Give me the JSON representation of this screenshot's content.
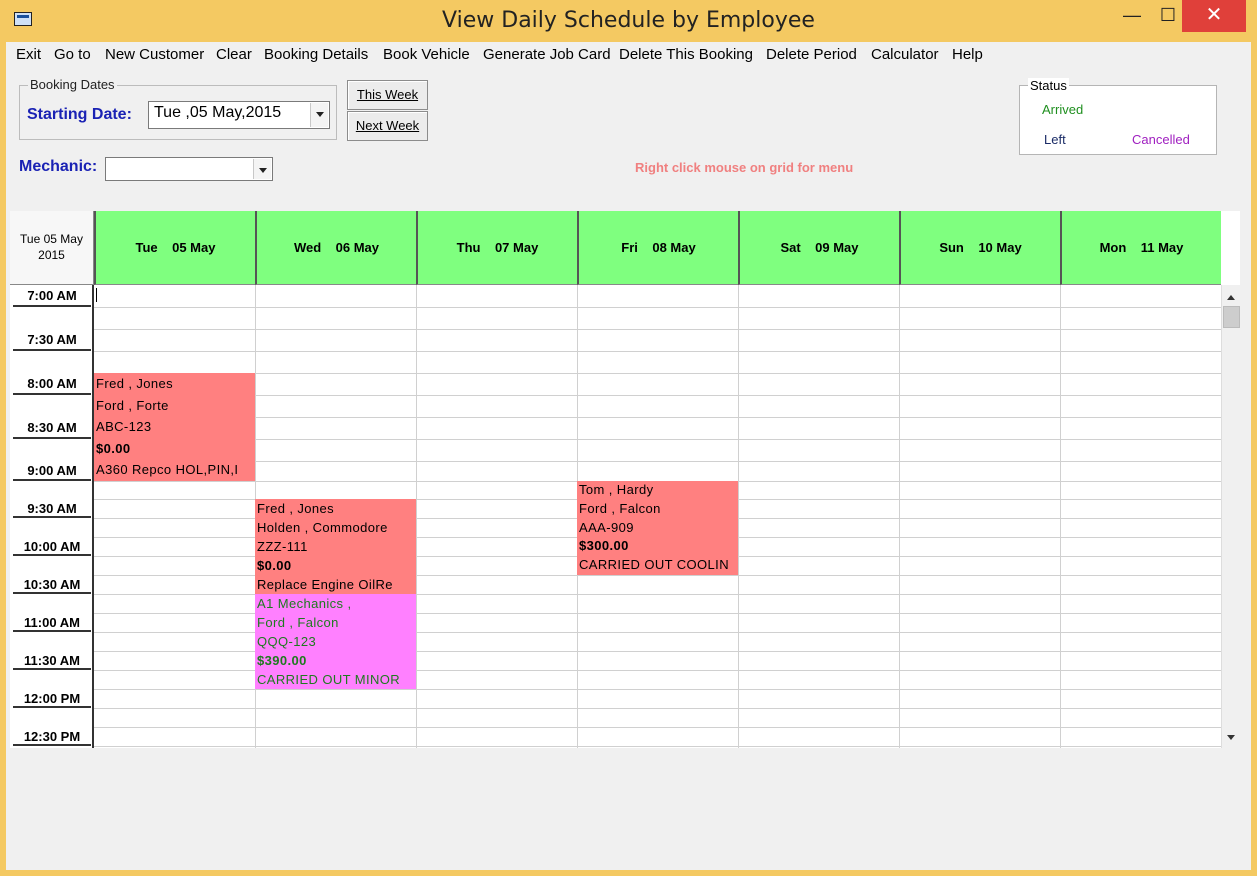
{
  "window": {
    "title": "View Daily Schedule by Employee",
    "minimize": "—",
    "maximize": "☐",
    "close": "✕"
  },
  "menu": [
    "Exit",
    "Go to",
    "New Customer",
    "Clear",
    "Booking Details",
    "Book Vehicle",
    "Generate Job Card",
    "Delete This Booking",
    "Delete Period",
    "Calculator",
    "Help"
  ],
  "booking_dates": {
    "legend": "Booking Dates",
    "starting_label": "Starting Date:",
    "starting_value": "Tue ,05 May,2015",
    "this_week": "This Week",
    "next_week": "Next Week"
  },
  "mechanic": {
    "label": "Mechanic:",
    "value": ""
  },
  "hint": "Right click mouse on grid for menu",
  "status": {
    "legend": "Status",
    "arrived": "Arrived",
    "left": "Left",
    "cancelled": "Cancelled",
    "colors": {
      "arrived": "#1f8f1f",
      "left": "#1a2b66",
      "cancelled": "#a020c0"
    }
  },
  "grid": {
    "corner_line1": "Tue 05 May",
    "corner_line2": "2015",
    "days": [
      "Tue    05 May",
      "Wed    06 May",
      "Thu    07 May",
      "Fri    08 May",
      "Sat    09 May",
      "Sun    10 May",
      "Mon    11 May"
    ],
    "times": [
      "7:00 AM",
      "7:30 AM",
      "8:00 AM",
      "8:30 AM",
      "9:00 AM",
      "9:30 AM",
      "10:00 AM",
      "10:30 AM",
      "11:00 AM",
      "11:30 AM",
      "12:00 PM",
      "12:30 PM"
    ],
    "appointments": [
      {
        "lines": [
          "Fred , Jones",
          "Ford , Forte",
          "ABC-123",
          "$0.00",
          " A360 Repco HOL,PIN,I"
        ],
        "color": "#ff8080",
        "text_color": "#000000"
      },
      {
        "lines": [
          "Fred , Jones",
          "Holden , Commodore",
          "ZZZ-111",
          "$0.00",
          "Replace Engine OilRe"
        ],
        "color": "#ff8080",
        "text_color": "#000000"
      },
      {
        "lines": [
          "A1 Mechanics ,",
          "Ford , Falcon",
          "QQQ-123",
          "$390.00",
          "CARRIED OUT MINOR"
        ],
        "color": "#ff80ff",
        "text_color": "#1f7a1f"
      },
      {
        "lines": [
          "Tom , Hardy",
          "Ford , Falcon",
          "AAA-909",
          "$300.00",
          "CARRIED OUT COOLIN"
        ],
        "color": "#ff8080",
        "text_color": "#000000"
      }
    ]
  }
}
